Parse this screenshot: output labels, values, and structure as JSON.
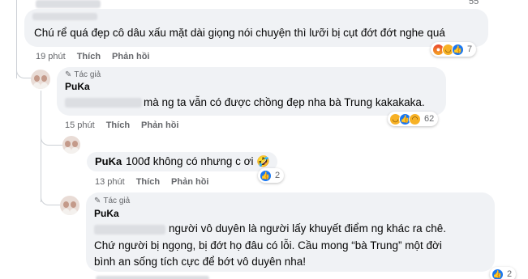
{
  "top_count": "55",
  "comment1": {
    "text": "Chú rể quá đẹp cô dâu xấu mặt dài giọng nói chuyện thì lưỡi bị cụt đớt đớt nghe quá",
    "time": "19 phút",
    "like_label": "Thích",
    "reply_label": "Phản hồi",
    "reaction_count": "7"
  },
  "reply1": {
    "author_badge": "Tác giả",
    "name": "PuKa",
    "text": "mà ng ta vẫn có được chồng đẹp nha bà Trung kakakaka.",
    "time": "15 phút",
    "like_label": "Thích",
    "reply_label": "Phản hồi",
    "reaction_count": "62"
  },
  "reply2": {
    "name": "PuKa",
    "text": "100đ không có nhưng c ơi",
    "emoji": "🤣",
    "time": "13 phút",
    "like_label": "Thích",
    "reply_label": "Phản hồi",
    "reaction_count": "2"
  },
  "reply3": {
    "author_badge": "Tác giả",
    "name": "PuKa",
    "line1": "người vô duyên là người lấy khuyết điểm ng khác ra chê.",
    "line2": "Chứ người bị ngọng, bị đớt họ đâu có lỗi. Cầu mong “bà Trung” một đời",
    "line3": "bình an sống tích cực để bớt vô duyên nha!",
    "reaction_count": "2"
  },
  "colors": {
    "bubble": "#f0f2f5",
    "meta_text": "#65676b",
    "like_blue": "#1877f2"
  }
}
